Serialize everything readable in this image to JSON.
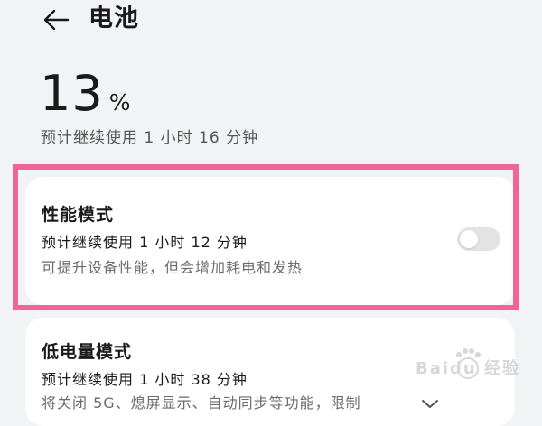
{
  "header": {
    "back_icon": "arrow-left-icon",
    "title": "电池"
  },
  "battery": {
    "percent": "13",
    "unit": "%",
    "remaining": "预计继续使用 1 小时 16 分钟"
  },
  "modes": {
    "performance": {
      "title": "性能模式",
      "remaining": "预计继续使用 1 小时 12 分钟",
      "description": "可提升设备性能，但会增加耗电和发热",
      "enabled": false
    },
    "low_power": {
      "title": "低电量模式",
      "remaining": "预计继续使用 1 小时 38 分钟",
      "description": "将关闭 5G、熄屏显示、自动同步等功能，限制"
    }
  },
  "colors": {
    "background": "#f1f3f5",
    "card": "#ffffff",
    "highlight": "#f06595",
    "toggle_off": "#e3e3e3"
  },
  "watermark": {
    "text": "Baidu 经验",
    "icon": "baidu-paw-icon"
  }
}
